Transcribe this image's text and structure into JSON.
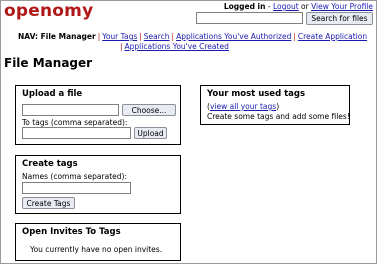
{
  "header": {
    "logo": "openomy",
    "logged_in": "Logged in",
    "dash": " - ",
    "logout": "Logout",
    "or": " or ",
    "view_profile": "View Your Profile",
    "search_placeholder": "",
    "search_button": "Search for files"
  },
  "nav": {
    "label": "NAV: File Manager",
    "sep": "|",
    "items": [
      "Your Tags",
      "Search",
      "Applications You've Authorized",
      "Create Application",
      "Applications You've Created"
    ]
  },
  "page_title": "File Manager",
  "upload": {
    "title": "Upload a file",
    "choose_button": "Choose...",
    "tags_label": "To tags (comma separated):",
    "upload_button": "Upload"
  },
  "create_tags": {
    "title": "Create tags",
    "names_label": "Names (comma separated):",
    "button": "Create Tags"
  },
  "invites": {
    "title": "Open Invites To Tags",
    "message": "You currently have no open invites."
  },
  "most_used": {
    "title": "Your most used tags",
    "open_paren": "(",
    "view_all": "view all your tags",
    "close_paren": ")",
    "message": "Create some tags and add some files!"
  }
}
